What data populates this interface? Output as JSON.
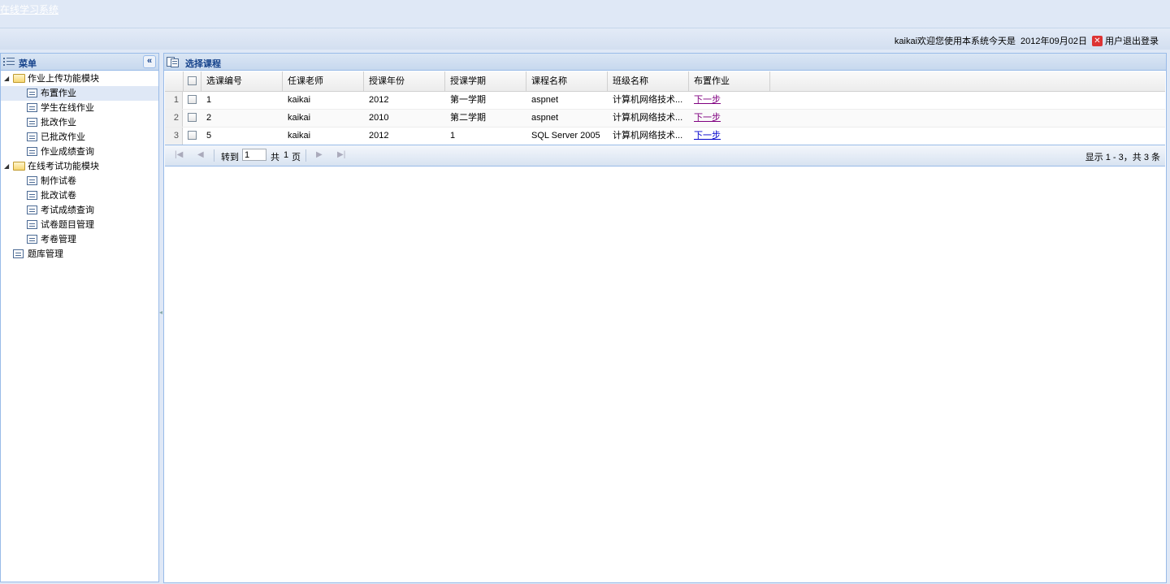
{
  "app": {
    "title": "在线学习系统"
  },
  "userbar": {
    "welcome": "kaikai欢迎您使用本系统今天是",
    "date": "2012年09月02日",
    "logout": "用户退出登录"
  },
  "menu": {
    "title": "菜单",
    "groups": [
      {
        "label": "作业上传功能模块",
        "items": [
          "布置作业",
          "学生在线作业",
          "批改作业",
          "已批改作业",
          "作业成绩查询"
        ]
      },
      {
        "label": "在线考试功能模块",
        "items": [
          "制作试卷",
          "批改试卷",
          "考试成绩查询",
          "试卷题目管理",
          "考卷管理"
        ]
      }
    ],
    "standalone": "题库管理"
  },
  "center": {
    "title": "选择课程",
    "columns": [
      "选课编号",
      "任课老师",
      "授课年份",
      "授课学期",
      "课程名称",
      "班级名称",
      "布置作业"
    ],
    "rows": [
      {
        "num": "1",
        "id": "1",
        "teacher": "kaikai",
        "year": "2012",
        "term": "第一学期",
        "course": "aspnet",
        "class": "计算机网络技术...",
        "action": "下一步"
      },
      {
        "num": "2",
        "id": "2",
        "teacher": "kaikai",
        "year": "2010",
        "term": "第二学期",
        "course": "aspnet",
        "class": "计算机网络技术...",
        "action": "下一步"
      },
      {
        "num": "3",
        "id": "5",
        "teacher": "kaikai",
        "year": "2012",
        "term": "1",
        "course": "SQL Server 2005",
        "class": "计算机网络技术...",
        "action": "下一步"
      }
    ]
  },
  "pager": {
    "goto_label": "转到",
    "page_value": "1",
    "total_prefix": "共",
    "total_pages": "1",
    "page_unit": "页",
    "summary": "显示 1 - 3，共 3 条"
  }
}
